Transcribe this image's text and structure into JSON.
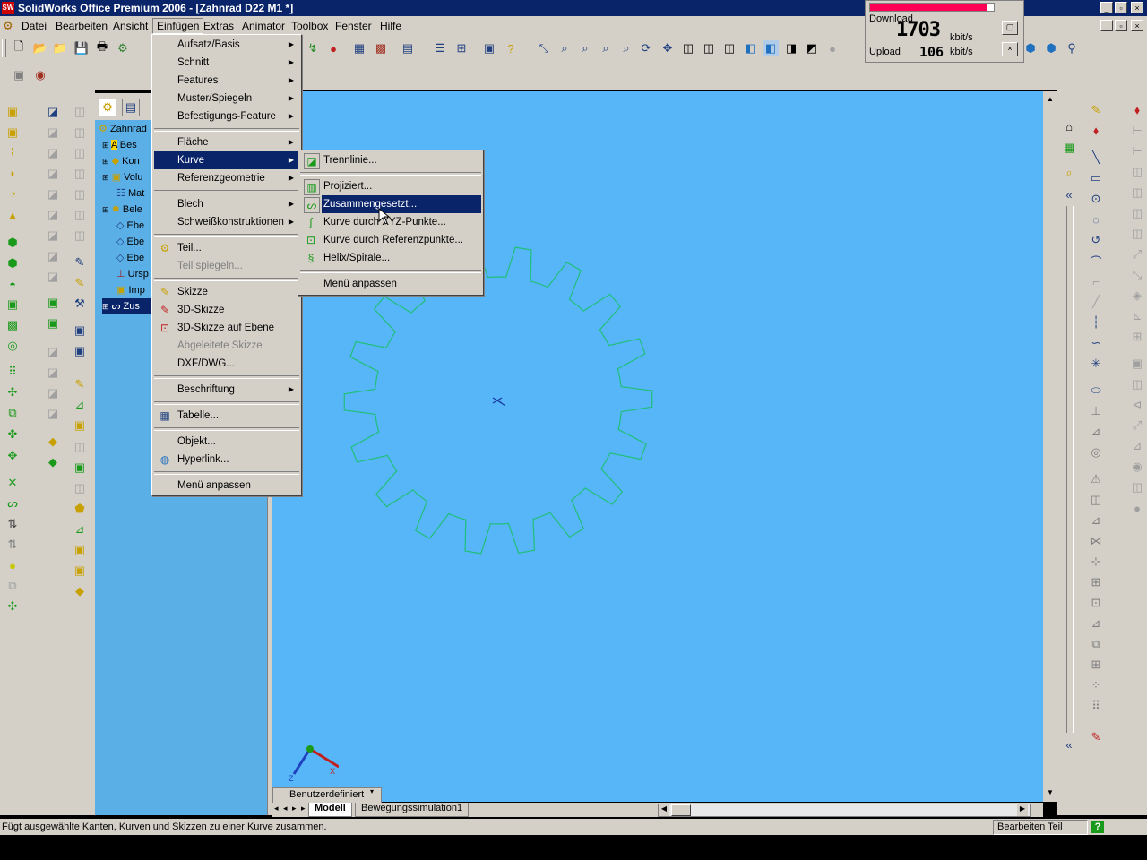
{
  "window": {
    "title": "SolidWorks Office Premium 2006 - [Zahnrad D22 M1 *]",
    "app_icon_text": "SW"
  },
  "menubar": {
    "items": [
      "Datei",
      "Bearbeiten",
      "Ansicht",
      "Einfügen",
      "Extras",
      "Animator",
      "Toolbox",
      "Fenster",
      "Hilfe"
    ],
    "open_item": "Einfügen"
  },
  "einfuegen_menu": {
    "items": [
      {
        "label": "Aufsatz/Basis",
        "submenu": true
      },
      {
        "label": "Schnitt",
        "submenu": true
      },
      {
        "label": "Features",
        "submenu": true
      },
      {
        "label": "Muster/Spiegeln",
        "submenu": true
      },
      {
        "label": "Befestigungs-Feature",
        "submenu": true
      },
      {
        "label": "Fläche",
        "submenu": true
      },
      {
        "label": "Kurve",
        "submenu": true,
        "highlighted": true
      },
      {
        "label": "Referenzgeometrie",
        "submenu": true
      },
      {
        "label": "Blech",
        "submenu": true
      },
      {
        "label": "Schweißkonstruktionen",
        "submenu": true
      },
      {
        "label": "Teil...",
        "icon": "part-icon"
      },
      {
        "label": "Teil spiegeln...",
        "disabled": true
      },
      {
        "label": "Skizze",
        "icon": "sketch-icon"
      },
      {
        "label": "3D-Skizze",
        "icon": "3d-sketch-icon"
      },
      {
        "label": "3D-Skizze auf Ebene",
        "icon": "3d-sketch-plane-icon"
      },
      {
        "label": "Abgeleitete Skizze",
        "disabled": true
      },
      {
        "label": "DXF/DWG..."
      },
      {
        "label": "Beschriftung",
        "submenu": true
      },
      {
        "label": "Tabelle...",
        "icon": "table-icon"
      },
      {
        "label": "Objekt..."
      },
      {
        "label": "Hyperlink...",
        "icon": "globe-icon"
      },
      {
        "label": "Menü anpassen"
      }
    ]
  },
  "kurve_submenu": {
    "items": [
      {
        "label": "Trennlinie...",
        "icon": "split-line-icon"
      },
      {
        "label": "Projiziert...",
        "icon": "projected-curve-icon"
      },
      {
        "label": "Zusammengesetzt...",
        "icon": "composite-curve-icon",
        "highlighted": true
      },
      {
        "label": "Kurve durch XYZ-Punkte...",
        "icon": "xyz-curve-icon"
      },
      {
        "label": "Kurve durch Referenzpunkte...",
        "icon": "ref-points-curve-icon"
      },
      {
        "label": "Helix/Spirale...",
        "icon": "helix-icon"
      },
      {
        "label": "Menü anpassen"
      }
    ]
  },
  "feature_tree": {
    "items": [
      {
        "label": "Zahnrad"
      },
      {
        "label": "Bes"
      },
      {
        "label": "Kon"
      },
      {
        "label": "Volu"
      },
      {
        "label": "Mat"
      },
      {
        "label": "Bele"
      },
      {
        "label": "Ebe"
      },
      {
        "label": "Ebe"
      },
      {
        "label": "Ebe"
      },
      {
        "label": "Ursp"
      },
      {
        "label": "Imp"
      },
      {
        "label": "Zus"
      }
    ]
  },
  "network_monitor": {
    "download_label": "Download",
    "download_value": "1703",
    "download_unit": "kbit/s",
    "upload_label": "Upload",
    "upload_value": "106",
    "upload_unit": "kbit/s",
    "download_level": 0.95
  },
  "view_orientation": {
    "label": "Benutzerdefiniert"
  },
  "tabs": {
    "items": [
      "Modell",
      "Bewegungssimulation1"
    ],
    "active": "Modell"
  },
  "statusbar": {
    "message": "Fügt ausgewählte Kanten, Kurven und Skizzen zu einer Kurve zusammen.",
    "mode": "Bearbeiten Teil",
    "help": "?"
  },
  "colors": {
    "viewport_bg": "#57b6f7",
    "tree_bg": "#5aafe7",
    "menu_highlight": "#0a246a",
    "gear_outline": "#1fbf7a",
    "netmon_bar": "#ff0055"
  }
}
